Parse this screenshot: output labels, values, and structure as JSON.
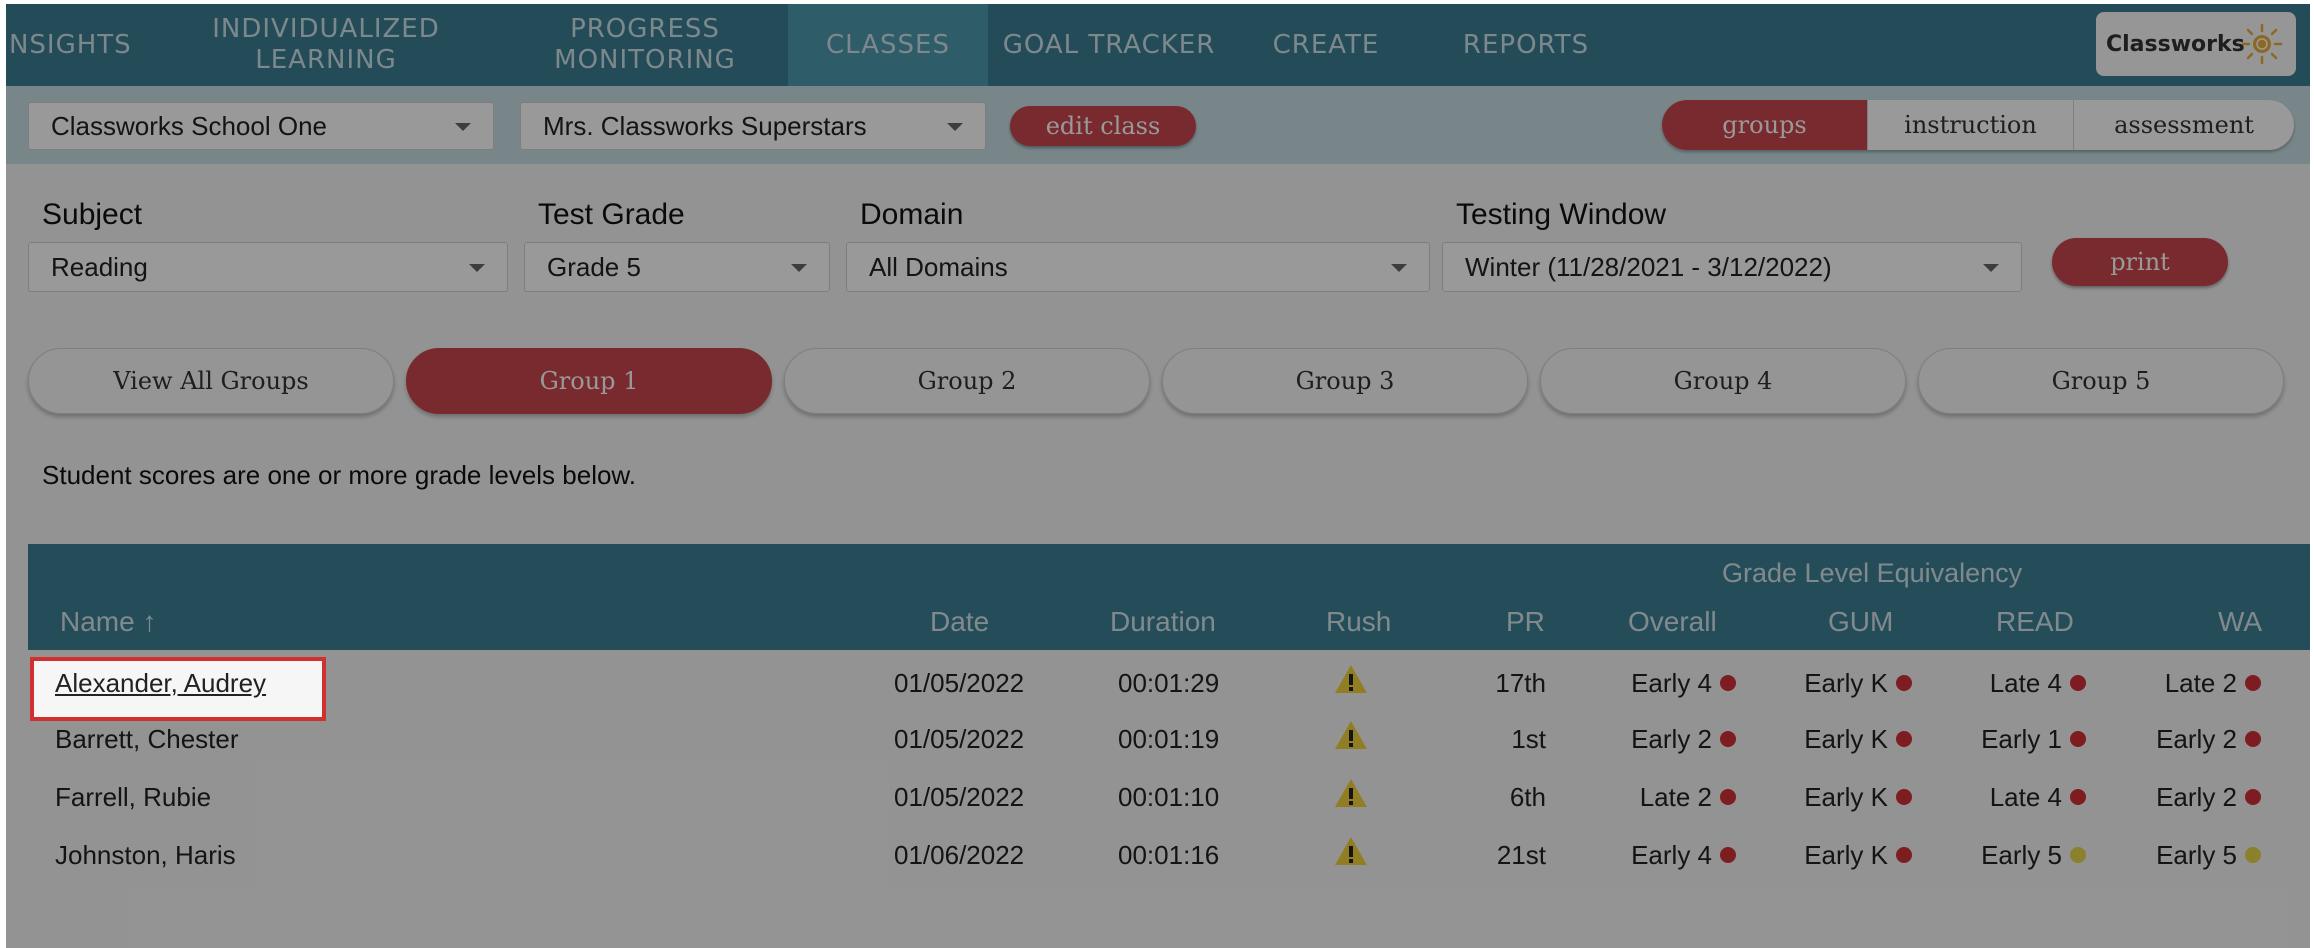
{
  "nav": {
    "items": [
      {
        "label": "INSIGHTS"
      },
      {
        "label": "INDIVIDUALIZED\nLEARNING"
      },
      {
        "label": "PROGRESS\nMONITORING"
      },
      {
        "label": "CLASSES"
      },
      {
        "label": "GOAL TRACKER"
      },
      {
        "label": "CREATE"
      },
      {
        "label": "REPORTS"
      }
    ],
    "active": "CLASSES",
    "logo_text": "Classworks"
  },
  "classbar": {
    "school": "Classworks School One",
    "class_name": "Mrs. Classworks Superstars",
    "edit_label": "edit class",
    "views": [
      "groups",
      "instruction",
      "assessment"
    ],
    "active_view": "groups"
  },
  "filters": {
    "subject": {
      "label": "Subject",
      "value": "Reading"
    },
    "test_grade": {
      "label": "Test Grade",
      "value": "Grade 5"
    },
    "domain": {
      "label": "Domain",
      "value": "All Domains"
    },
    "testing_window": {
      "label": "Testing Window",
      "value": "Winter (11/28/2021 - 3/12/2022)"
    },
    "print_label": "print"
  },
  "groups": {
    "tabs": [
      "View All Groups",
      "Group 1",
      "Group 2",
      "Group 3",
      "Group 4",
      "Group 5"
    ],
    "active": "Group 1",
    "note": "Student scores are one or more grade levels below."
  },
  "table": {
    "super_header": "Grade Level Equivalency",
    "columns": [
      "Name ↑",
      "Date",
      "Duration",
      "Rush",
      "PR",
      "Overall",
      "GUM",
      "READ",
      "WA"
    ],
    "rows": [
      {
        "name": "Alexander, Audrey",
        "date": "01/05/2022",
        "duration": "00:01:29",
        "pr": "17th",
        "overall": "Early 4",
        "gum": "Early K",
        "read": "Late 4",
        "wa": "Late 2",
        "read_color": "#d0313a",
        "wa_color": "#d0313a"
      },
      {
        "name": "Barrett, Chester",
        "date": "01/05/2022",
        "duration": "00:01:19",
        "pr": "1st",
        "overall": "Early 2",
        "gum": "Early K",
        "read": "Early 1",
        "wa": "Early 2",
        "read_color": "#d0313a",
        "wa_color": "#d0313a"
      },
      {
        "name": "Farrell, Rubie",
        "date": "01/05/2022",
        "duration": "00:01:10",
        "pr": "6th",
        "overall": "Late 2",
        "gum": "Early K",
        "read": "Late 4",
        "wa": "Early 2",
        "read_color": "#d0313a",
        "wa_color": "#d0313a"
      },
      {
        "name": "Johnston, Haris",
        "date": "01/06/2022",
        "duration": "00:01:16",
        "pr": "21st",
        "overall": "Early 4",
        "gum": "Early K",
        "read": "Early 5",
        "wa": "Early 5",
        "read_color": "#e8d64a",
        "wa_color": "#e8d64a"
      }
    ],
    "low_color": "#d0313a",
    "warning_color": "#f2d23a"
  }
}
